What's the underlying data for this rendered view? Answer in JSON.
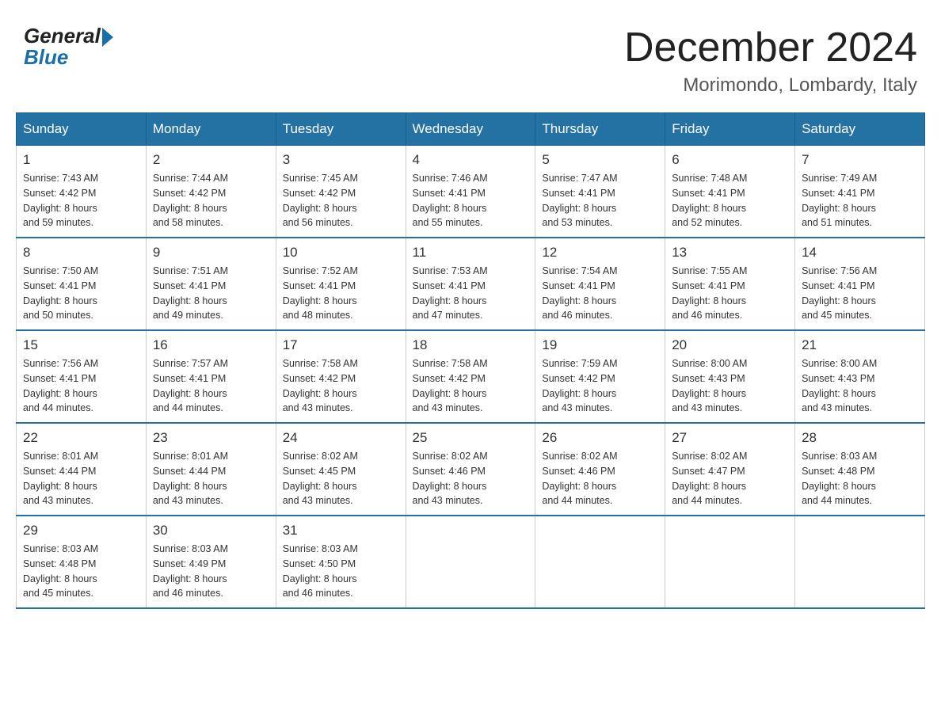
{
  "header": {
    "logo_general": "General",
    "logo_blue": "Blue",
    "month_title": "December 2024",
    "location": "Morimondo, Lombardy, Italy"
  },
  "days_of_week": [
    "Sunday",
    "Monday",
    "Tuesday",
    "Wednesday",
    "Thursday",
    "Friday",
    "Saturday"
  ],
  "weeks": [
    [
      {
        "day": "1",
        "sunrise": "7:43 AM",
        "sunset": "4:42 PM",
        "daylight": "8 hours and 59 minutes."
      },
      {
        "day": "2",
        "sunrise": "7:44 AM",
        "sunset": "4:42 PM",
        "daylight": "8 hours and 58 minutes."
      },
      {
        "day": "3",
        "sunrise": "7:45 AM",
        "sunset": "4:42 PM",
        "daylight": "8 hours and 56 minutes."
      },
      {
        "day": "4",
        "sunrise": "7:46 AM",
        "sunset": "4:41 PM",
        "daylight": "8 hours and 55 minutes."
      },
      {
        "day": "5",
        "sunrise": "7:47 AM",
        "sunset": "4:41 PM",
        "daylight": "8 hours and 53 minutes."
      },
      {
        "day": "6",
        "sunrise": "7:48 AM",
        "sunset": "4:41 PM",
        "daylight": "8 hours and 52 minutes."
      },
      {
        "day": "7",
        "sunrise": "7:49 AM",
        "sunset": "4:41 PM",
        "daylight": "8 hours and 51 minutes."
      }
    ],
    [
      {
        "day": "8",
        "sunrise": "7:50 AM",
        "sunset": "4:41 PM",
        "daylight": "8 hours and 50 minutes."
      },
      {
        "day": "9",
        "sunrise": "7:51 AM",
        "sunset": "4:41 PM",
        "daylight": "8 hours and 49 minutes."
      },
      {
        "day": "10",
        "sunrise": "7:52 AM",
        "sunset": "4:41 PM",
        "daylight": "8 hours and 48 minutes."
      },
      {
        "day": "11",
        "sunrise": "7:53 AM",
        "sunset": "4:41 PM",
        "daylight": "8 hours and 47 minutes."
      },
      {
        "day": "12",
        "sunrise": "7:54 AM",
        "sunset": "4:41 PM",
        "daylight": "8 hours and 46 minutes."
      },
      {
        "day": "13",
        "sunrise": "7:55 AM",
        "sunset": "4:41 PM",
        "daylight": "8 hours and 46 minutes."
      },
      {
        "day": "14",
        "sunrise": "7:56 AM",
        "sunset": "4:41 PM",
        "daylight": "8 hours and 45 minutes."
      }
    ],
    [
      {
        "day": "15",
        "sunrise": "7:56 AM",
        "sunset": "4:41 PM",
        "daylight": "8 hours and 44 minutes."
      },
      {
        "day": "16",
        "sunrise": "7:57 AM",
        "sunset": "4:41 PM",
        "daylight": "8 hours and 44 minutes."
      },
      {
        "day": "17",
        "sunrise": "7:58 AM",
        "sunset": "4:42 PM",
        "daylight": "8 hours and 43 minutes."
      },
      {
        "day": "18",
        "sunrise": "7:58 AM",
        "sunset": "4:42 PM",
        "daylight": "8 hours and 43 minutes."
      },
      {
        "day": "19",
        "sunrise": "7:59 AM",
        "sunset": "4:42 PM",
        "daylight": "8 hours and 43 minutes."
      },
      {
        "day": "20",
        "sunrise": "8:00 AM",
        "sunset": "4:43 PM",
        "daylight": "8 hours and 43 minutes."
      },
      {
        "day": "21",
        "sunrise": "8:00 AM",
        "sunset": "4:43 PM",
        "daylight": "8 hours and 43 minutes."
      }
    ],
    [
      {
        "day": "22",
        "sunrise": "8:01 AM",
        "sunset": "4:44 PM",
        "daylight": "8 hours and 43 minutes."
      },
      {
        "day": "23",
        "sunrise": "8:01 AM",
        "sunset": "4:44 PM",
        "daylight": "8 hours and 43 minutes."
      },
      {
        "day": "24",
        "sunrise": "8:02 AM",
        "sunset": "4:45 PM",
        "daylight": "8 hours and 43 minutes."
      },
      {
        "day": "25",
        "sunrise": "8:02 AM",
        "sunset": "4:46 PM",
        "daylight": "8 hours and 43 minutes."
      },
      {
        "day": "26",
        "sunrise": "8:02 AM",
        "sunset": "4:46 PM",
        "daylight": "8 hours and 44 minutes."
      },
      {
        "day": "27",
        "sunrise": "8:02 AM",
        "sunset": "4:47 PM",
        "daylight": "8 hours and 44 minutes."
      },
      {
        "day": "28",
        "sunrise": "8:03 AM",
        "sunset": "4:48 PM",
        "daylight": "8 hours and 44 minutes."
      }
    ],
    [
      {
        "day": "29",
        "sunrise": "8:03 AM",
        "sunset": "4:48 PM",
        "daylight": "8 hours and 45 minutes."
      },
      {
        "day": "30",
        "sunrise": "8:03 AM",
        "sunset": "4:49 PM",
        "daylight": "8 hours and 46 minutes."
      },
      {
        "day": "31",
        "sunrise": "8:03 AM",
        "sunset": "4:50 PM",
        "daylight": "8 hours and 46 minutes."
      },
      null,
      null,
      null,
      null
    ]
  ]
}
